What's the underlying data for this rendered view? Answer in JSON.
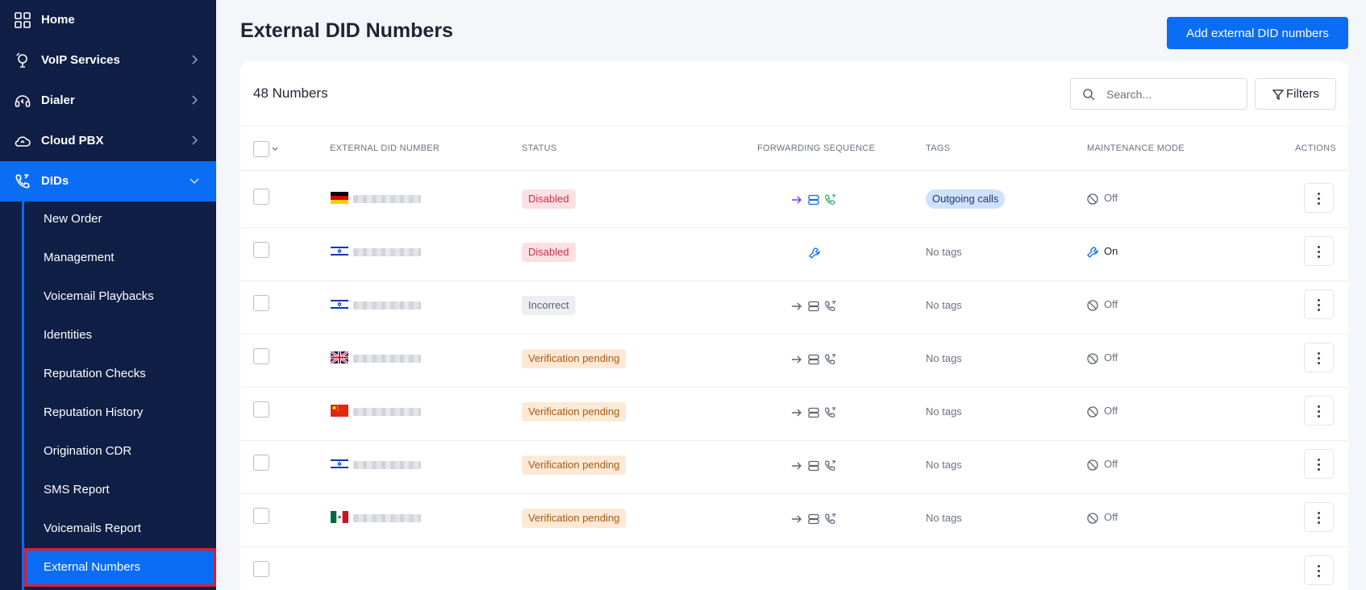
{
  "sidebar": {
    "items": [
      {
        "label": "Home",
        "icon": "grid-icon"
      },
      {
        "label": "VoIP Services",
        "icon": "voip-icon"
      },
      {
        "label": "Dialer",
        "icon": "headset-icon"
      },
      {
        "label": "Cloud PBX",
        "icon": "cloud-icon"
      },
      {
        "label": "DIDs",
        "icon": "phone-icon",
        "active": true
      }
    ],
    "sub_items": [
      {
        "label": "New Order"
      },
      {
        "label": "Management"
      },
      {
        "label": "Voicemail Playbacks"
      },
      {
        "label": "Identities"
      },
      {
        "label": "Reputation Checks"
      },
      {
        "label": "Reputation History"
      },
      {
        "label": "Origination CDR"
      },
      {
        "label": "SMS Report"
      },
      {
        "label": "Voicemails Report"
      },
      {
        "label": "External Numbers",
        "active": true
      }
    ]
  },
  "page": {
    "title": "External DID Numbers",
    "add_button": "Add external DID numbers"
  },
  "toolbar": {
    "count": "48 Numbers",
    "search_placeholder": "Search...",
    "filters_label": "Filters"
  },
  "table": {
    "columns": [
      "EXTERNAL DID NUMBER",
      "STATUS",
      "FORWARDING SEQUENCE",
      "TAGS",
      "MAINTENANCE MODE",
      "ACTIONS"
    ],
    "rows": [
      {
        "flag": "DE",
        "status": "Disabled",
        "status_type": "disabled",
        "forwarding": "colored",
        "tags": "Outgoing calls",
        "maintenance": "Off"
      },
      {
        "flag": "IL",
        "status": "Disabled",
        "status_type": "disabled",
        "forwarding": "wrench",
        "tags": "No tags",
        "maintenance": "On"
      },
      {
        "flag": "IL",
        "status": "Incorrect",
        "status_type": "incorrect",
        "forwarding": "gray",
        "tags": "No tags",
        "maintenance": "Off"
      },
      {
        "flag": "GB",
        "status": "Verification pending",
        "status_type": "pending",
        "forwarding": "gray",
        "tags": "No tags",
        "maintenance": "Off"
      },
      {
        "flag": "CN",
        "status": "Verification pending",
        "status_type": "pending",
        "forwarding": "gray",
        "tags": "No tags",
        "maintenance": "Off"
      },
      {
        "flag": "IL",
        "status": "Verification pending",
        "status_type": "pending",
        "forwarding": "gray",
        "tags": "No tags",
        "maintenance": "Off"
      },
      {
        "flag": "MX",
        "status": "Verification pending",
        "status_type": "pending",
        "forwarding": "gray",
        "tags": "No tags",
        "maintenance": "Off"
      }
    ]
  },
  "colors": {
    "sidebar_bg": "#0f1f45",
    "accent": "#0b6cf5",
    "highlight_outline": "#e31b23"
  }
}
